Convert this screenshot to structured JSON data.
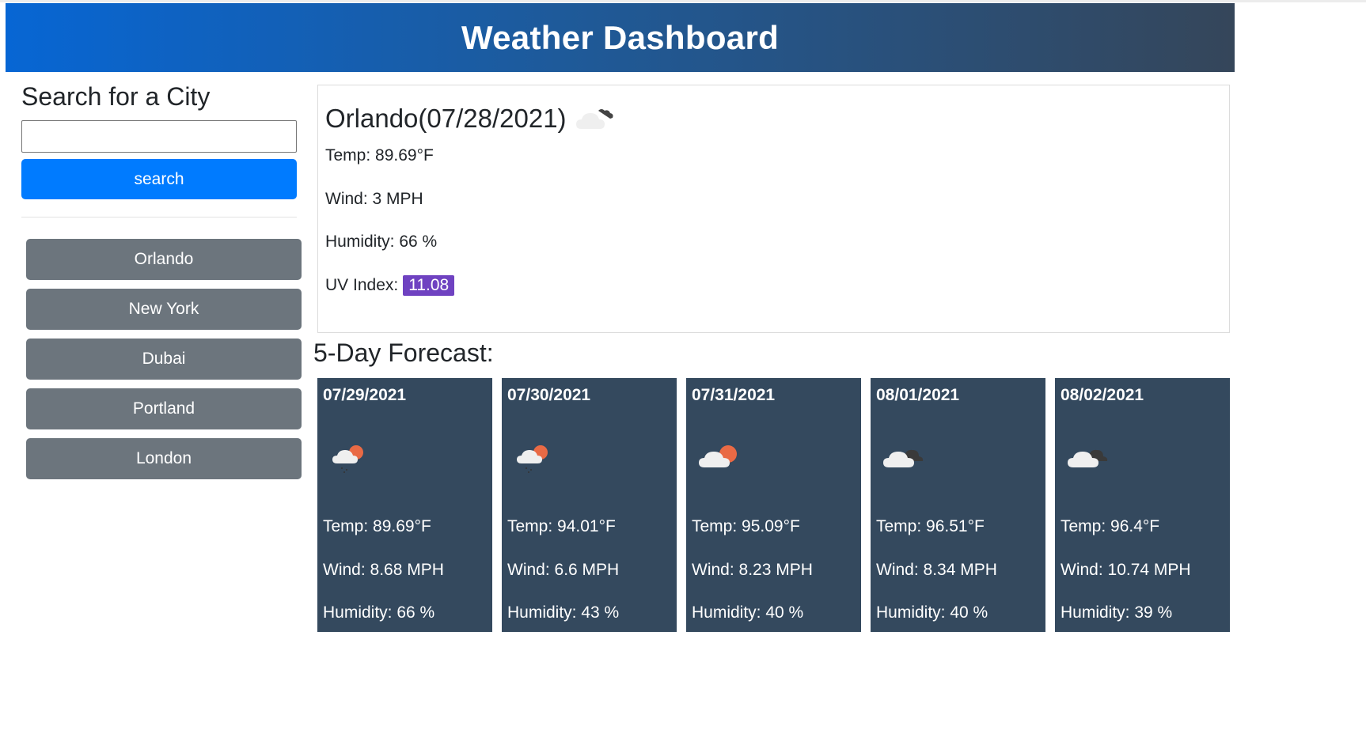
{
  "header": {
    "title": "Weather Dashboard"
  },
  "sidebar": {
    "heading": "Search for a City",
    "search_value": "",
    "search_placeholder": "",
    "search_button": "search",
    "cities": [
      "Orlando",
      "New York",
      "Dubai",
      "Portland",
      "London"
    ]
  },
  "current": {
    "title": "Orlando(07/28/2021)",
    "icon": "broken-clouds-icon",
    "temp": "Temp: 89.69°F",
    "wind": "Wind: 3 MPH",
    "humidity": "Humidity: 66 %",
    "uv_label": "UV Index:",
    "uv_value": "11.08",
    "uv_color": "#6f42c1"
  },
  "forecast": {
    "title": "5-Day Forecast:",
    "days": [
      {
        "date": "07/29/2021",
        "icon": "light-rain-sun-icon",
        "temp": "Temp: 89.69°F",
        "wind": "Wind: 8.68 MPH",
        "humidity": "Humidity: 66 %"
      },
      {
        "date": "07/30/2021",
        "icon": "light-rain-sun-icon",
        "temp": "Temp: 94.01°F",
        "wind": "Wind: 6.6 MPH",
        "humidity": "Humidity: 43 %"
      },
      {
        "date": "07/31/2021",
        "icon": "few-clouds-sun-icon",
        "temp": "Temp: 95.09°F",
        "wind": "Wind: 8.23 MPH",
        "humidity": "Humidity: 40 %"
      },
      {
        "date": "08/01/2021",
        "icon": "overcast-clouds-icon",
        "temp": "Temp: 96.51°F",
        "wind": "Wind: 8.34 MPH",
        "humidity": "Humidity: 40 %"
      },
      {
        "date": "08/02/2021",
        "icon": "overcast-clouds-icon",
        "temp": "Temp: 96.4°F",
        "wind": "Wind: 10.74 MPH",
        "humidity": "Humidity: 39 %"
      }
    ]
  },
  "colors": {
    "primary": "#007bff",
    "secondary": "#6c757d",
    "card": "#34495e",
    "uv": "#6f42c1"
  }
}
